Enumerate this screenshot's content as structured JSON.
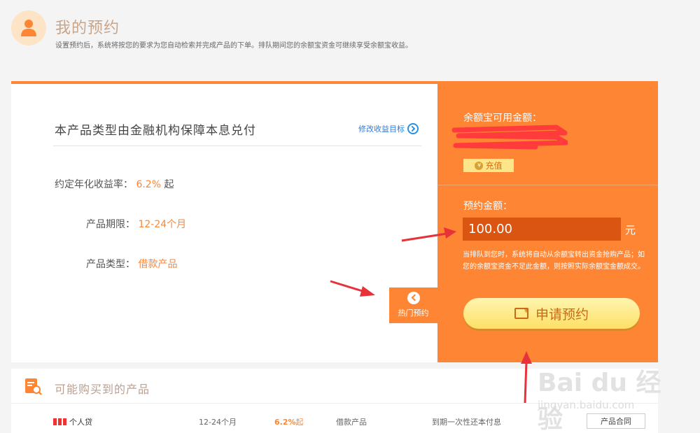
{
  "header": {
    "title": "我的预约",
    "desc": "设置预约后，系统将按您的要求为您自动检索并完成产品的下单。排队期间您的余额宝资金可继续享受余额宝收益。"
  },
  "detail": {
    "guarantee_text": "本产品类型由金融机构保障本息兑付",
    "modify_link": "修改收益目标",
    "rate_label": "约定年化收益率：",
    "rate_value": "6.2%",
    "rate_suffix": "起",
    "term_label": "产品期限：",
    "term_value": "12-24个月",
    "type_label": "产品类型：",
    "type_value": "借款产品",
    "hot_tab": "热门预约"
  },
  "panel": {
    "available_label": "余额宝可用金额：",
    "recharge_label": "充值",
    "amount_label": "预约金额：",
    "amount_value": "100.00",
    "unit": "元",
    "note": "当排队到您时，系统将自动从余额宝转出资金抢购产品；如您的余额宝资金不足此金额，则按照实际余额宝金额成交。",
    "apply_button": "申请预约"
  },
  "products": {
    "title": "可能购买到的产品",
    "rows": [
      {
        "name": "个人贷",
        "term": "12-24个月",
        "rate": "6.2%",
        "rate_suffix": "起",
        "type": "借款产品",
        "repay": "到期一次性还本付息",
        "contract": "产品合同"
      }
    ]
  },
  "watermark": {
    "main": "Bai du 经验",
    "sub": "jingyan.baidu.com"
  },
  "colors": {
    "accent": "#fe8533",
    "input_bg": "#db5512",
    "button_yellow": "#fde065",
    "annotation_red": "#e8323a"
  }
}
